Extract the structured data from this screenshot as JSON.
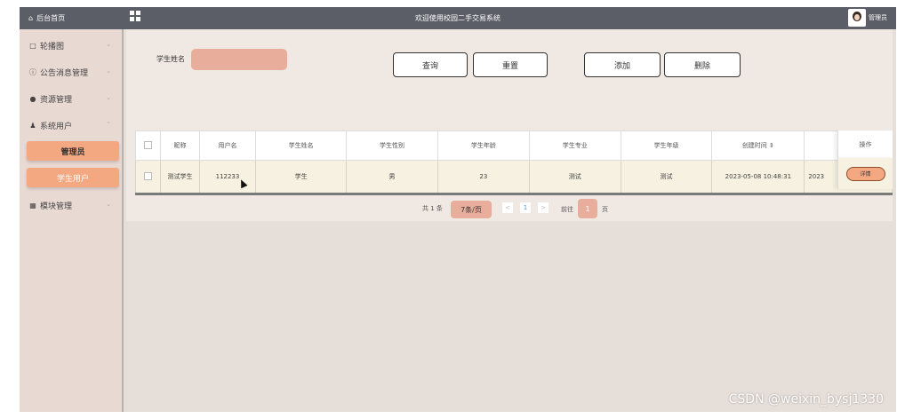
{
  "topbar": {
    "home_label": "后台首页",
    "title": "欢迎使用校园二手交易系统",
    "user_name": "管理员"
  },
  "sidebar": {
    "items": [
      {
        "label": "轮播图",
        "icon": "image-icon"
      },
      {
        "label": "公告消息管理",
        "icon": "info-icon"
      },
      {
        "label": "资源管理",
        "icon": "location-icon"
      },
      {
        "label": "系统用户",
        "icon": "user-icon"
      }
    ],
    "submenu": [
      "管理员",
      "学生用户"
    ],
    "after": {
      "label": "模块管理",
      "icon": "grid-icon"
    }
  },
  "search": {
    "label": "学生姓名",
    "value": ""
  },
  "toolbar": {
    "query": "查询",
    "reset": "重置",
    "add": "添加",
    "delete": "删除"
  },
  "table": {
    "headers": [
      "昵称",
      "用户名",
      "学生姓名",
      "学生性别",
      "学生年龄",
      "学生专业",
      "学生年级",
      "创建时间 ⇕",
      "操作"
    ],
    "rows": [
      [
        "测试学生",
        "112233",
        "学生",
        "男",
        "23",
        "测试",
        "测试",
        "2023-05-08 10:48:31",
        "2023"
      ]
    ],
    "action": "详情"
  },
  "pager": {
    "total": "共 1 条",
    "page_size": "7条/页",
    "prev": "<",
    "page": "1",
    "next": ">",
    "goto": "前往",
    "goto_value": "1",
    "suffix": "页"
  },
  "watermark": "CSDN @weixin_bysj1330",
  "colors": {
    "topbar": "#5b5e66",
    "sidebar": "#e8d9d3",
    "accent": "#f4a882",
    "input": "#e8ae9b",
    "row": "#f6f1e0"
  }
}
